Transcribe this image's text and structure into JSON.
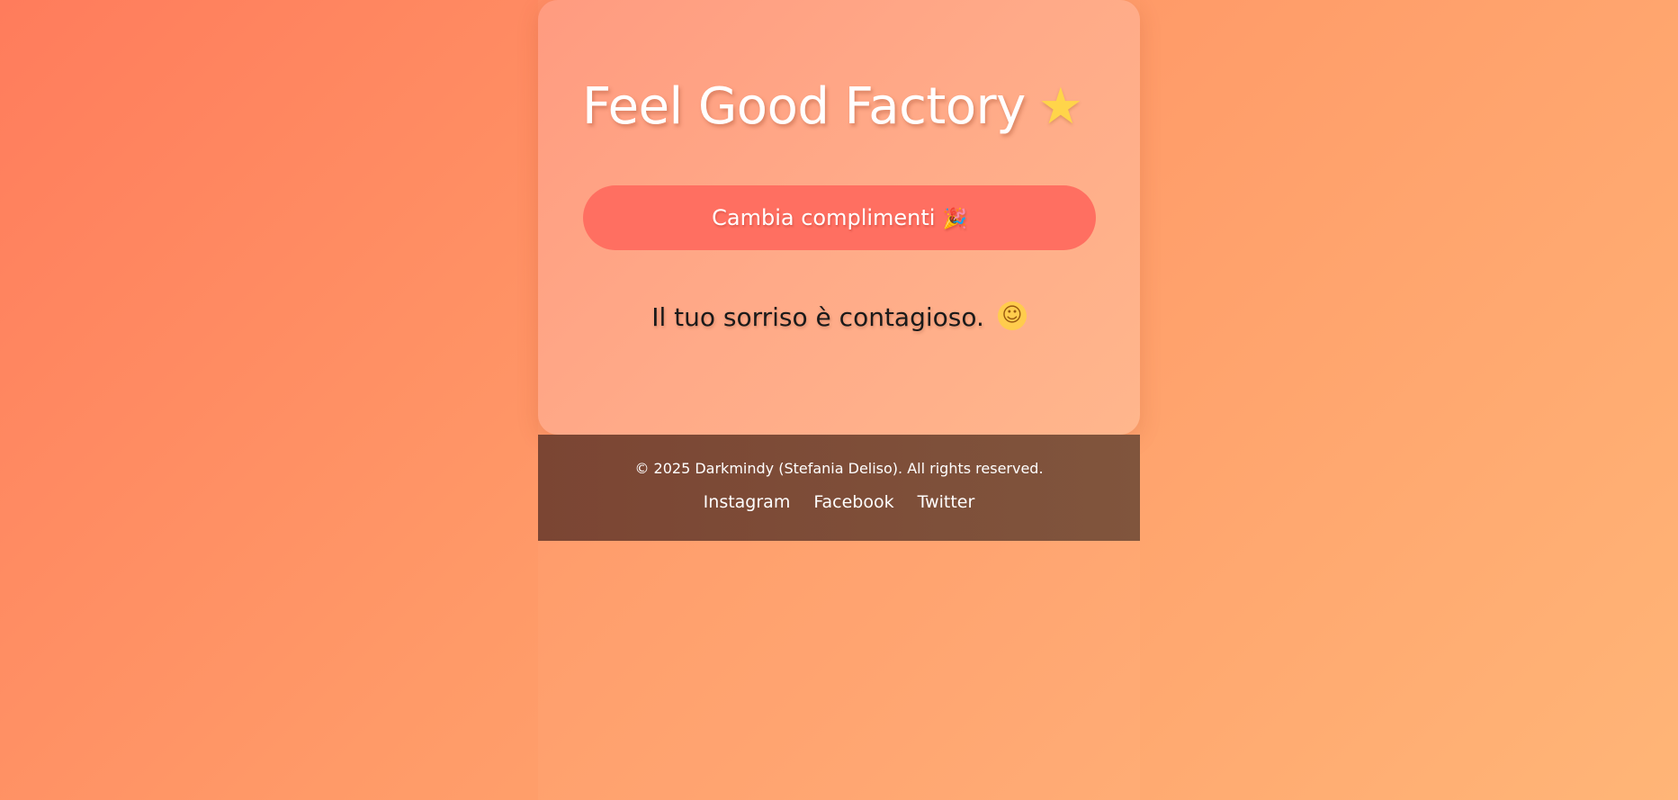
{
  "header": {
    "title": "Feel Good Factory",
    "title_icon": "star-icon",
    "title_icon_glyph": "★"
  },
  "action": {
    "button_label": "Cambia complimenti",
    "button_icon": "party-popper-icon",
    "button_icon_glyph": "🎉"
  },
  "compliment": {
    "text": "Il tuo sorriso è contagioso.",
    "icon": "smiling-face-icon",
    "icon_glyph": "☺"
  },
  "footer": {
    "copyright": "© 2025 Darkmindy (Stefania Deliso). All rights reserved.",
    "links": [
      {
        "label": "Instagram"
      },
      {
        "label": "Facebook"
      },
      {
        "label": "Twitter"
      }
    ]
  },
  "colors": {
    "background_start": "#ff7c5c",
    "background_end": "#ffb577",
    "button": "#ff6f61",
    "footer": "#7b4533",
    "title_text": "#ffffff",
    "compliment_text": "#1a1a1a"
  }
}
